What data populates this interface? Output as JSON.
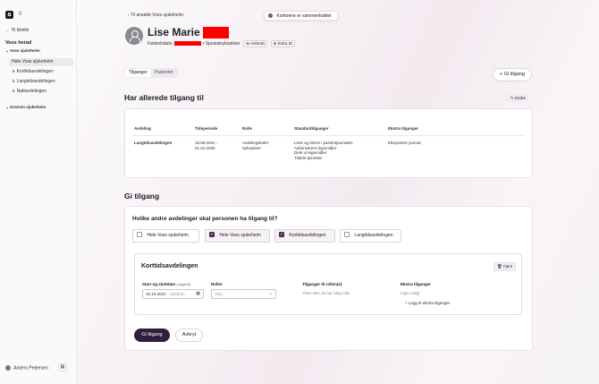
{
  "sidebar": {
    "logo": "a",
    "org_count": "0",
    "back_label": "Til klinikk",
    "heading": "Voss herad",
    "groups": [
      {
        "label": "Voss sjukeheim"
      },
      {
        "label": "Granvin sjukeheim"
      }
    ],
    "items": [
      {
        "label": "Hele Voss sjukeheim"
      },
      {
        "label": "Korttidsavdelingen"
      },
      {
        "label": "Langtidsavdelingen"
      },
      {
        "label": "Nattavdelingen"
      }
    ],
    "user_name": "Anders Pedersen"
  },
  "header": {
    "back_label": "Til ansatte Voss sjukeheim",
    "toast": "Kontoene er sammenkoblet",
    "name": "Lise Marie",
    "birth_label": "Fødselsdato:",
    "role": "Spesialsykepleier",
    "chips": [
      "HelseID",
      "Entra ID"
    ]
  },
  "tabs": [
    "Tilganger",
    "Pasienter"
  ],
  "give_access_button": "Gi tilgang",
  "existing": {
    "title": "Har allerede tilgang til",
    "edit_label": "Endre",
    "columns": [
      "Avdeling",
      "Tidsperiode",
      "Rolle",
      "Standardtilganger",
      "Ekstra tilganger"
    ],
    "row": {
      "department": "Langtidsavdelingen",
      "period": [
        "18.09.2024 -",
        "01.01.2025"
      ],
      "role": [
        "Avdelingsleder",
        "Sykepleier"
      ],
      "standard": [
        "Lese og skrive i pasientjournalen",
        "Administrere legemidler",
        "Dele ut legemidler",
        "Tildele tjenester"
      ],
      "extra": "Eksportere journal"
    }
  },
  "give": {
    "title": "Gi tilgang",
    "question": "Hvilke andre avdelinger skal personen ha tilgang til?",
    "options": [
      {
        "label": "Hele Voss sjukeheim",
        "checked": false
      },
      {
        "label": "Hele Voss sjukeheim",
        "checked": true
      },
      {
        "label": "Korttidsavdelingen",
        "checked": true
      },
      {
        "label": "Langtidsavdelingen",
        "checked": false
      }
    ],
    "section": {
      "title": "Korttidsavdelingen",
      "remove_label": "Fjern",
      "date_label": "Start og sluttdato",
      "date_optional": "(valgfritt)",
      "date_start": "16.10.2024",
      "date_end_placeholder": "- sluttdato",
      "roles_label": "Roller",
      "roles_placeholder": "Velg",
      "role_access_label": "Tilganger til rollen(e)",
      "role_access_hint": "Vises etter du har valgt rolle",
      "extra_label": "Ekstra tilganger",
      "extra_value": "Ingen valgt",
      "add_extra": "Legg til ekstra tilganger"
    },
    "submit": "Gi tilgang",
    "cancel": "Avbryt"
  }
}
